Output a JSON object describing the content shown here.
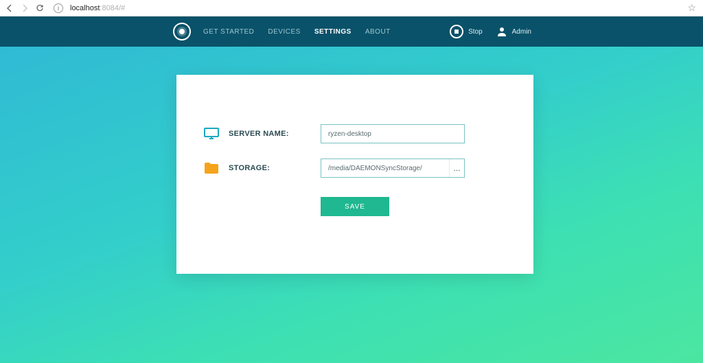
{
  "browser": {
    "url_host": "localhost",
    "url_rest": ":8084/#"
  },
  "header": {
    "nav": {
      "get_started": "GET STARTED",
      "devices": "DEVICES",
      "settings": "SETTINGS",
      "about": "ABOUT"
    },
    "stop_label": "Stop",
    "admin_label": "Admin"
  },
  "form": {
    "server_name_label": "SERVER NAME:",
    "server_name_value": "ryzen-desktop",
    "storage_label": "STORAGE:",
    "storage_value": "/media/DAEMONSyncStorage/",
    "browse_label": "...",
    "save_label": "SAVE"
  }
}
